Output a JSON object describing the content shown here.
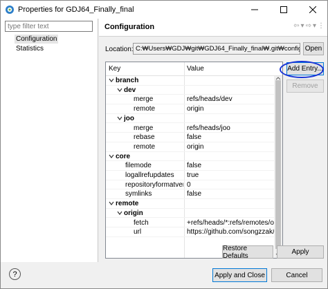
{
  "window": {
    "title": "Properties for GDJ64_Finally_final"
  },
  "left": {
    "filter_placeholder": "type filter text",
    "items": [
      {
        "label": "Configuration"
      },
      {
        "label": "Statistics"
      }
    ]
  },
  "right": {
    "title": "Configuration",
    "location_label": "Location:",
    "location_value": "C:₩Users₩GDJ₩git₩GDJ64_Finally_final₩.git₩config",
    "open_label": "Open",
    "add_entry_label": "Add Entry...",
    "remove_label": "Remove",
    "restore_label": "Restore Defaults",
    "apply_label": "Apply"
  },
  "table": {
    "headers": {
      "key": "Key",
      "value": "Value"
    },
    "rows": [
      {
        "key": "branch",
        "value": ""
      },
      {
        "key": "dev",
        "value": ""
      },
      {
        "key": "merge",
        "value": "refs/heads/dev"
      },
      {
        "key": "remote",
        "value": "origin"
      },
      {
        "key": "joo",
        "value": ""
      },
      {
        "key": "merge",
        "value": "refs/heads/joo"
      },
      {
        "key": "rebase",
        "value": "false"
      },
      {
        "key": "remote",
        "value": "origin"
      },
      {
        "key": "core",
        "value": ""
      },
      {
        "key": "filemode",
        "value": "false"
      },
      {
        "key": "logallrefupdates",
        "value": "true"
      },
      {
        "key": "repositoryformatversi",
        "value": "0"
      },
      {
        "key": "symlinks",
        "value": "false"
      },
      {
        "key": "remote",
        "value": ""
      },
      {
        "key": "origin",
        "value": ""
      },
      {
        "key": "fetch",
        "value": "+refs/heads/*:refs/remotes/ori"
      },
      {
        "key": "url",
        "value": "https://github.com/songzzak/"
      }
    ]
  },
  "footer": {
    "apply_close_label": "Apply and Close",
    "cancel_label": "Cancel"
  }
}
